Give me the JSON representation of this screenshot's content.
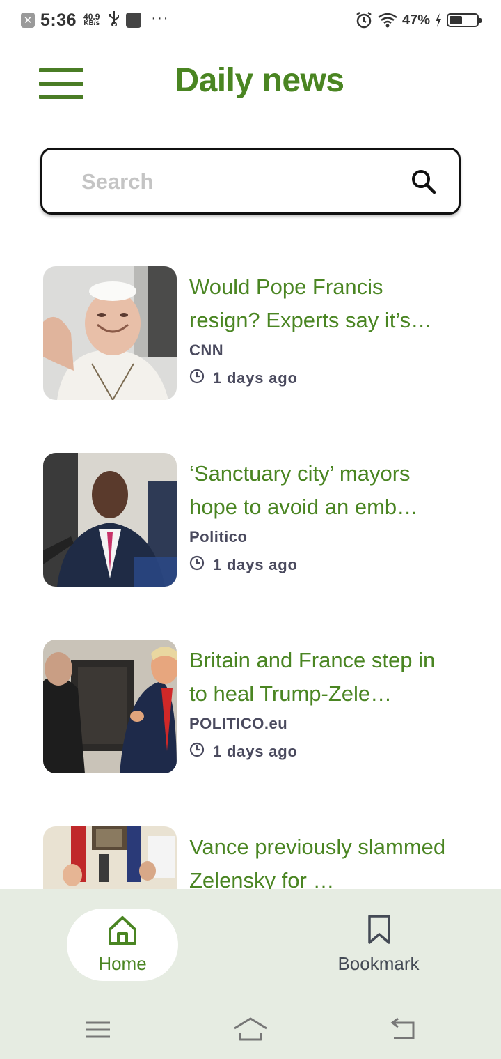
{
  "status_bar": {
    "close_badge": "✕",
    "time": "5:36",
    "net_speed_value": "40.9",
    "net_speed_unit": "KB/s",
    "usb_symbol": "⚲",
    "dots": "···",
    "battery_percent": "47%",
    "battery_level": 0.47
  },
  "header": {
    "title": "Daily news"
  },
  "search": {
    "placeholder": "Search",
    "value": ""
  },
  "articles": [
    {
      "title": "Would Pope Francis resign? Experts say it’s…",
      "source": "CNN",
      "time": "1 days ago",
      "thumbnail": "pope-francis-photo"
    },
    {
      "title": "‘Sanctuary city’ mayors hope to avoid an emb…",
      "source": "Politico",
      "time": "1 days ago",
      "thumbnail": "mayor-press-photo"
    },
    {
      "title": "Britain and France step in to heal Trump-Zele…",
      "source": "POLITICO.eu",
      "time": "1 days ago",
      "thumbnail": "trump-zelensky-photo"
    },
    {
      "title": "Vance previously slammed Zelensky for …",
      "source": "",
      "time": "",
      "thumbnail": "oval-office-photo"
    }
  ],
  "bottom_nav": {
    "items": [
      {
        "label": "Home",
        "icon": "home-icon",
        "active": true
      },
      {
        "label": "Bookmark",
        "icon": "bookmark-icon",
        "active": false
      }
    ]
  },
  "colors": {
    "brand_green": "#4a8522",
    "nav_background": "#e6ece2",
    "meta_text": "#4a4a5e"
  }
}
